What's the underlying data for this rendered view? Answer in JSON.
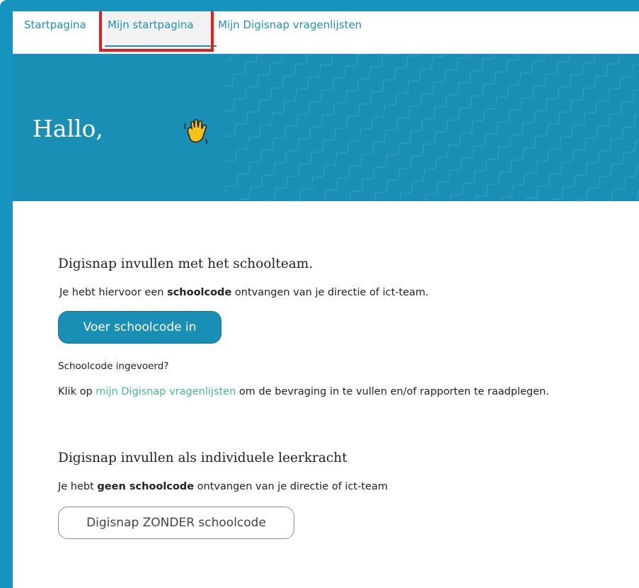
{
  "nav": {
    "tabs": [
      {
        "label": "Startpagina"
      },
      {
        "label": "Mijn startpagina",
        "active": true
      },
      {
        "label": "Mijn Digisnap vragenlijsten"
      }
    ]
  },
  "hero": {
    "greeting": "Hallo,",
    "wave_emoji": "waving-hand-icon"
  },
  "school": {
    "heading": "Digisnap invullen met het schoolteam.",
    "intro_before": "Je hebt hiervoor een ",
    "intro_bold": "schoolcode",
    "intro_after": " ontvangen van je directie of ict-team.",
    "button_label": "Voer schoolcode in",
    "question": "Schoolcode ingevoerd?",
    "info_before": "Klik op ",
    "info_link": "mijn Digisnap vragenlijsten",
    "info_after": " om de bevraging in te vullen en/of rapporten te raadplegen."
  },
  "individual": {
    "heading": "Digisnap invullen als individuele leerkracht",
    "intro_before": "Je hebt ",
    "intro_bold": "geen schoolcode",
    "intro_after": " ontvangen van je directie of ict-team",
    "button_label": "Digisnap ZONDER schoolcode"
  },
  "colors": {
    "brand": "#1a8fb5",
    "link": "#40b99a",
    "highlight": "#e01f1f"
  }
}
